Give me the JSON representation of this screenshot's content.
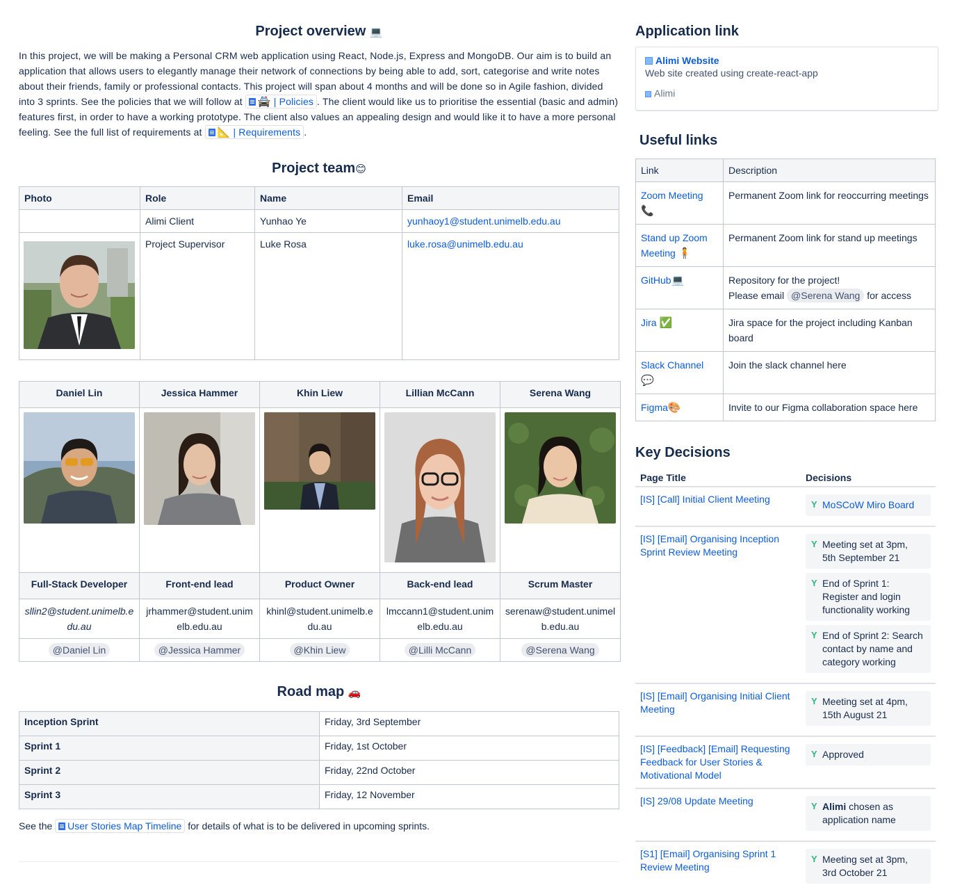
{
  "overview": {
    "title": "Project overview",
    "title_emoji": "💻",
    "p1": "In this project, we will be making a Personal CRM web application using React, Node.js, Express and MongoDB. Our aim is to build an application that allows users to elegantly manage their network of connections by being able to add, sort, categorise and write notes about their friends, family or professional contacts. This project will span about 4 months and will be done so in Agile fashion, divided into 3 sprints. See the policies that we will follow at ",
    "policies_emoji": "🚔",
    "policies_link": "| Policies",
    "p2": ". The client would like us to prioritise the essential (basic and admin) features first, in order to have a working prototype. The client also values an appealing design and would like it to have a more personal feeling. See the full list of requirements at ",
    "requirements_emoji": "📐",
    "requirements_link": "| Requirements",
    "p3": "."
  },
  "team": {
    "title": "Project team",
    "title_emoji": "😊",
    "headers": [
      "Photo",
      "Role",
      "Name",
      "Email"
    ],
    "rows": [
      {
        "role": "Alimi Client",
        "name": "Yunhao Ye",
        "email": "yunhaoy1@student.unimelb.edu.au"
      },
      {
        "role": "Project Supervisor",
        "name": "Luke Rosa",
        "email": "luke.rosa@unimelb.edu.au"
      }
    ],
    "members": [
      {
        "name": "Daniel Lin",
        "role": "Full-Stack Developer",
        "email": "sllin2@student.unimelb.edu.au",
        "mention": "@Daniel Lin"
      },
      {
        "name": "Jessica Hammer",
        "role": "Front-end lead",
        "email": "jrhammer@student.unimelb.edu.au",
        "mention": "@Jessica Hammer"
      },
      {
        "name": "Khin Liew",
        "role": "Product Owner",
        "email": "khinl@student.unimelb.edu.au",
        "mention": "@Khin Liew"
      },
      {
        "name": "Lillian McCann",
        "role": "Back-end lead",
        "email": "lmccann1@student.unimelb.edu.au",
        "mention": "@Lilli McCann"
      },
      {
        "name": "Serena Wang",
        "role": "Scrum Master",
        "email": "serenaw@student.unimelb.edu.au",
        "mention": "@Serena Wang"
      }
    ]
  },
  "roadmap": {
    "title": "Road map",
    "title_emoji": "🚗",
    "rows": [
      {
        "sprint": "Inception Sprint",
        "date": "Friday, 3rd September"
      },
      {
        "sprint": "Sprint 1",
        "date": "Friday, 1st October"
      },
      {
        "sprint": "Sprint 2",
        "date": "Friday, 22nd October"
      },
      {
        "sprint": "Sprint 3",
        "date": "Friday, 12 November"
      }
    ],
    "footer_pre": "See the ",
    "footer_link": "User Stories Map Timeline",
    "footer_post": " for details of what is to be delivered in upcoming sprints."
  },
  "app_link": {
    "title": "Application link",
    "site_title": "Alimi Website",
    "site_desc": "Web site created using create-react-app",
    "site_name": "Alimi"
  },
  "useful": {
    "title": "Useful links",
    "headers": [
      "Link",
      "Description"
    ],
    "rows": [
      {
        "link": "Zoom Meeting",
        "emoji": "📞",
        "desc": "Permanent Zoom link for reoccurring meetings"
      },
      {
        "link": "Stand up Zoom Meeting",
        "emoji": "🧍",
        "desc": "Permanent Zoom link for stand up meetings"
      },
      {
        "link": "GitHub",
        "emoji": "💻",
        "desc": "Repository for the project!",
        "desc2_pre": "Please email ",
        "desc2_mention": "@Serena Wang",
        "desc2_post": " for access"
      },
      {
        "link": "Jira",
        "emoji": "✅",
        "desc": "Jira space for the project including Kanban board"
      },
      {
        "link": "Slack Channel",
        "emoji": "💬",
        "desc": "Join the slack channel here"
      },
      {
        "link": "Figma",
        "emoji": "🎨",
        "desc": "Invite to our Figma collaboration space here"
      }
    ]
  },
  "key_decisions": {
    "title": "Key Decisions",
    "headers": [
      "Page Title",
      "Decisions"
    ],
    "rows": [
      {
        "page": "[IS] [Call] Initial Client Meeting",
        "decisions": [
          "MoSCoW Miro Board"
        ],
        "link_decision": true
      },
      {
        "page": "[IS] [Email] Organising Inception Sprint Review Meeting",
        "decisions": [
          "Meeting set at 3pm, 5th September 21",
          "End of Sprint 1: Register and login functionality working",
          "End of Sprint 2: Search contact by name and category working"
        ]
      },
      {
        "page": "[IS] [Email] Organising Initial Client Meeting",
        "decisions": [
          "Meeting set at 4pm, 15th August 21"
        ]
      },
      {
        "page": "[IS] [Feedback] [Email] Requesting Feedback for User Stories & Motivational Model",
        "decisions": [
          "Approved"
        ]
      },
      {
        "page": "[IS] 29/08 Update Meeting",
        "decisions_bold": "Alimi",
        "decisions": [
          " chosen as application name"
        ]
      },
      {
        "page": "[S1] [Email] Organising Sprint 1 Review Meeting",
        "decisions": [
          "Meeting set at 3pm, 3rd October 21"
        ]
      }
    ]
  },
  "colors": {
    "link": "#0c5cd9",
    "text": "#172b4d",
    "header_bg": "#f4f5f7",
    "border": "#c1c7d0",
    "decision_icon": "#36b37e"
  }
}
